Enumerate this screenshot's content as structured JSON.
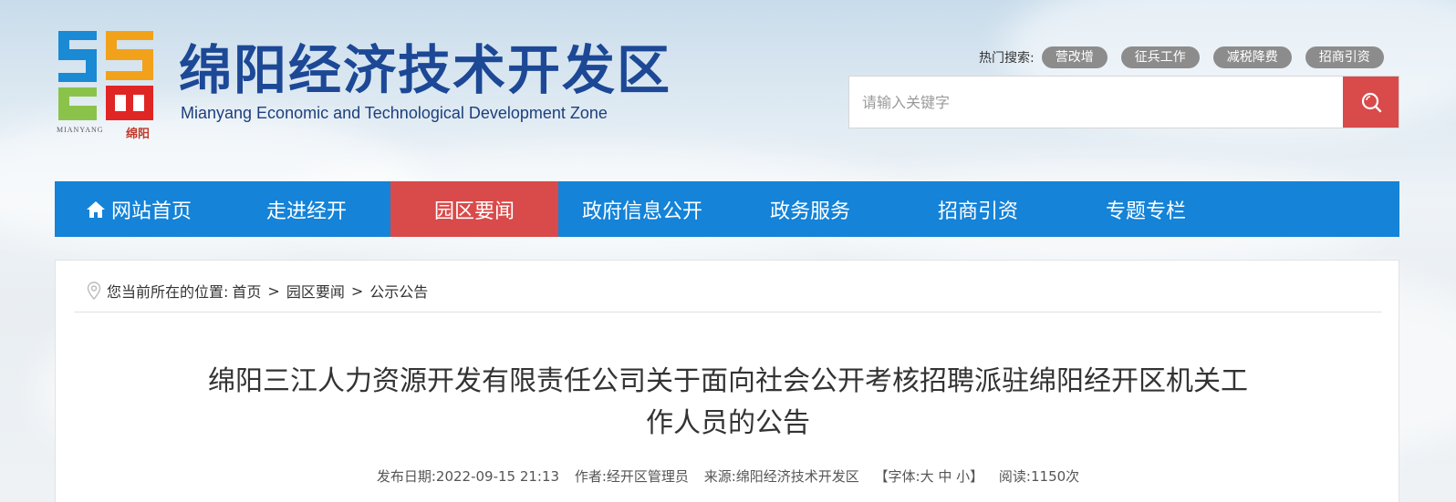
{
  "site": {
    "title": "绵阳经济技术开发区",
    "subtitle": "Mianyang Economic and Technological Development Zone",
    "logo_text_en": "MIANYANG",
    "logo_text_cn": "绵阳"
  },
  "hot_search": {
    "label": "热门搜索:",
    "tags": [
      "营改增",
      "征兵工作",
      "减税降费",
      "招商引资"
    ]
  },
  "search": {
    "placeholder": "请输入关键字"
  },
  "nav": {
    "items": [
      "网站首页",
      "走进经开",
      "园区要闻",
      "政府信息公开",
      "政务服务",
      "招商引资",
      "专题专栏"
    ],
    "active_index": 2
  },
  "breadcrumb": {
    "prefix": "您当前所在的位置:",
    "items": [
      "首页",
      "园区要闻",
      "公示公告"
    ],
    "separator": ">"
  },
  "article": {
    "title_line1": "绵阳三江人力资源开发有限责任公司关于面向社会公开考核招聘派驻绵阳经开区机关工",
    "title_line2": "作人员的公告",
    "meta": {
      "date": "发布日期:2022-09-15 21:13",
      "author": "作者:经开区管理员",
      "source": "来源:绵阳经济技术开发区",
      "font_size": "【字体:大 中 小】",
      "reads": "阅读:1150次"
    }
  },
  "colors": {
    "brand_blue": "#1483d8",
    "accent_red": "#d94a4a",
    "title_blue": "#1c4896"
  }
}
